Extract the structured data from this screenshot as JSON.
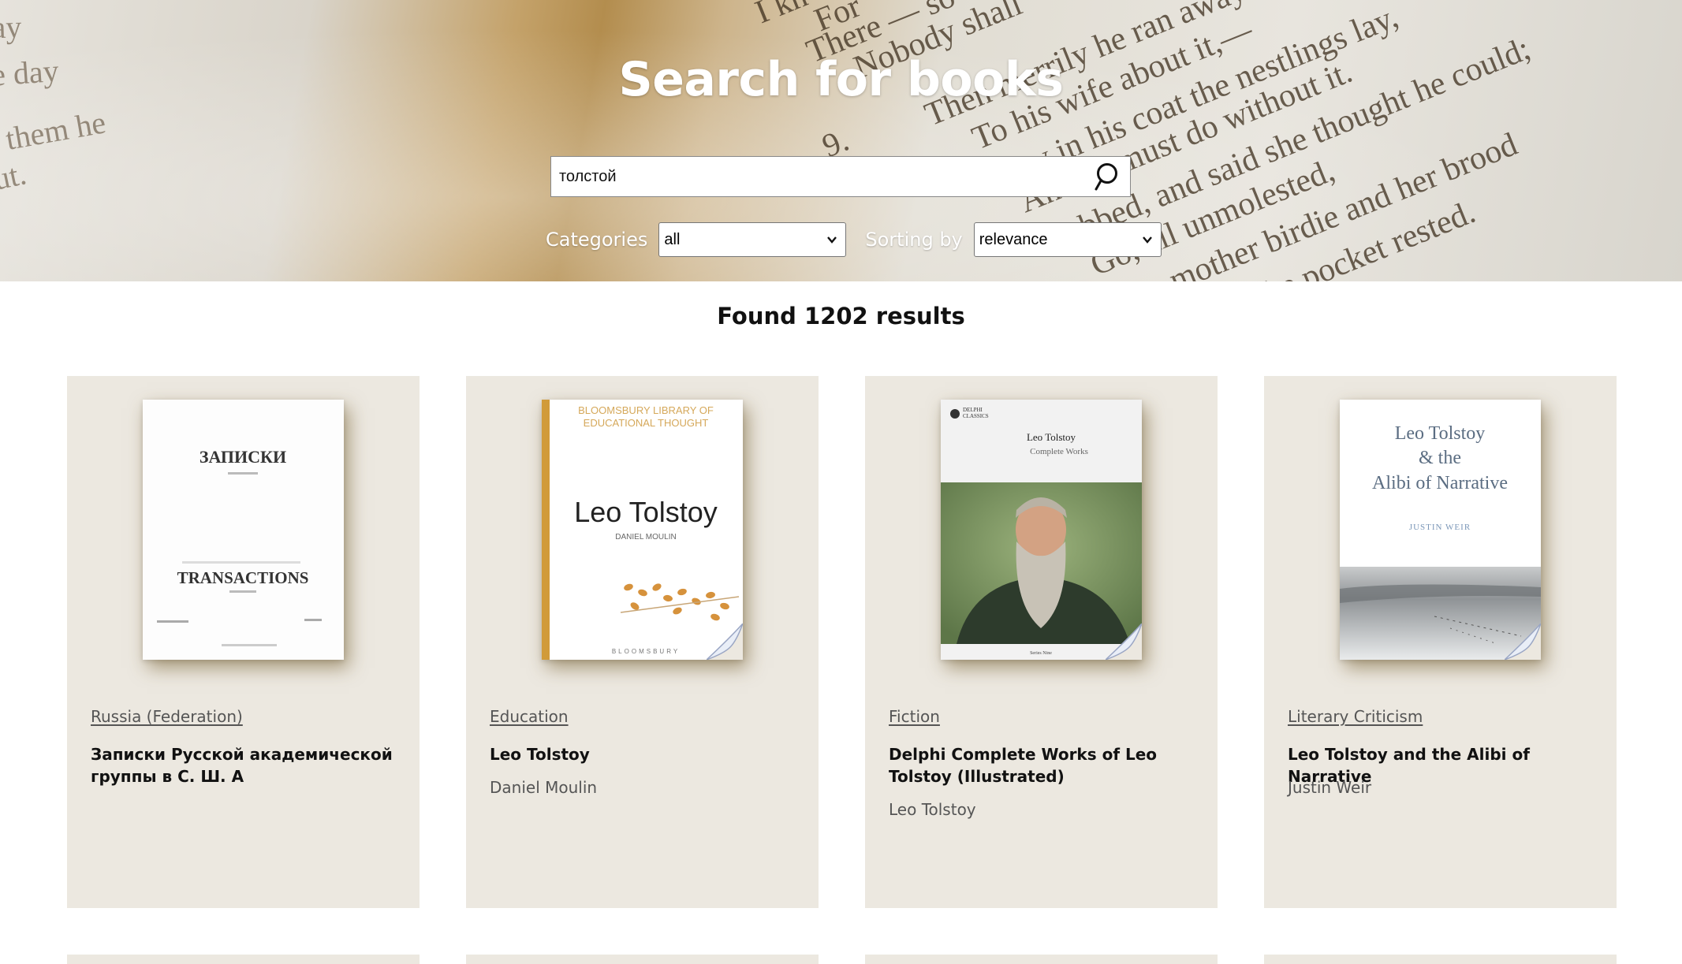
{
  "header": {
    "title": "Search for books"
  },
  "search": {
    "value": "толстой",
    "button_icon": "search-icon"
  },
  "filters": {
    "categories_label": "Categories",
    "categories_selected": "all",
    "sorting_label": "Sorting by",
    "sorting_selected": "relevance"
  },
  "results": {
    "count_text": "Found 1202 results"
  },
  "books": [
    {
      "category": "Russia (Federation)",
      "title": "Записки Русской академической группы в С. Ш. А",
      "author": "",
      "cover_text_top": "ЗАПИСКИ",
      "cover_text_bottom": "TRANSACTIONS"
    },
    {
      "category": "Education",
      "title": "Leo Tolstoy",
      "author": "Daniel Moulin",
      "cover_series": "BLOOMSBURY LIBRARY OF EDUCATIONAL THOUGHT",
      "cover_title": "Leo Tolstoy",
      "cover_author": "DANIEL MOULIN",
      "cover_publisher": "BLOOMSBURY"
    },
    {
      "category": "Fiction",
      "title": "Delphi Complete Works of Leo Tolstoy (Illustrated)",
      "author": "Leo Tolstoy",
      "cover_brand": "DELPHI CLASSICS",
      "cover_title": "Leo Tolstoy",
      "cover_subtitle": "Complete Works"
    },
    {
      "category": "Literary Criticism",
      "title": "Leo Tolstoy and the Alibi of Narrative",
      "author": "Justin Weir",
      "cover_title_1": "Leo Tolstoy",
      "cover_title_2": "& the",
      "cover_title_3": "Alibi of Narrative",
      "cover_author": "JUSTIN WEIR"
    }
  ],
  "colors": {
    "card_bg": "#ece8e0",
    "hero_accent": "#b38d4e",
    "text_dark": "#111111",
    "text_muted": "#555555"
  }
}
